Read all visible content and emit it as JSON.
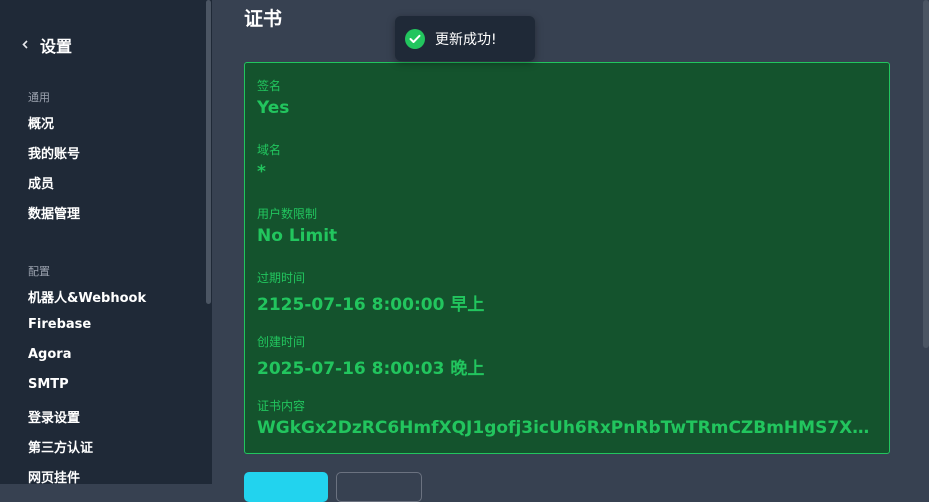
{
  "sidebar": {
    "back_label": "设置",
    "sections": [
      {
        "label": "通用",
        "items": [
          "概况",
          "我的账号",
          "成员",
          "数据管理"
        ]
      },
      {
        "label": "配置",
        "items": [
          "机器人&Webhook",
          "Firebase",
          "Agora",
          "SMTP",
          "登录设置",
          "第三方认证",
          "网页挂件"
        ]
      }
    ]
  },
  "main": {
    "title": "证书",
    "fields": [
      {
        "label": "签名",
        "value": "Yes"
      },
      {
        "label": "域名",
        "value": "*"
      },
      {
        "label": "用户数限制",
        "value": "No Limit"
      },
      {
        "label": "过期时间",
        "value": "2125-07-16 8:00:00 早上"
      },
      {
        "label": "创建时间",
        "value": "2025-07-16 8:00:03 晚上"
      },
      {
        "label": "证书内容",
        "value": "WGkGx2DzRC6HmfXQJ1gofj3icUh6RxPnRbTwTRmCZBmHMS7XZ..."
      }
    ]
  },
  "toast": {
    "message": "更新成功!"
  },
  "colors": {
    "accent_green": "#22c55e",
    "card_bg": "#14532d",
    "primary_button": "#22d3ee",
    "sidebar_bg": "#1f2937",
    "main_bg": "#374151"
  }
}
